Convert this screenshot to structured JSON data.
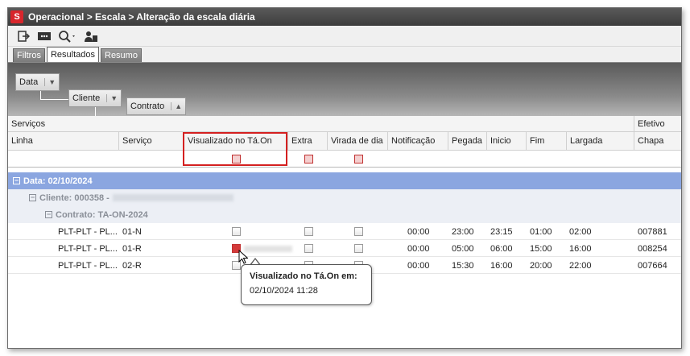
{
  "window": {
    "title": "Operacional > Escala > Alteração da escala diária",
    "logo_letter": "S"
  },
  "toolbar": {
    "icons": [
      "export-icon",
      "message-icon",
      "search-icon",
      "users-icon"
    ]
  },
  "tabs": [
    {
      "label": "Filtros",
      "active": false
    },
    {
      "label": "Resultados",
      "active": true
    },
    {
      "label": "Resumo",
      "active": false
    }
  ],
  "grouping": {
    "chips": [
      {
        "label": "Data",
        "sort": "▼"
      },
      {
        "label": "Cliente",
        "sort": "▼"
      },
      {
        "label": "Contrato",
        "sort": "▲"
      }
    ]
  },
  "grid": {
    "band_headers": {
      "servicos": "Serviços",
      "efetivo": "Efetivo"
    },
    "columns": [
      "Linha",
      "Serviço",
      "Visualizado no Tá.On",
      "Extra",
      "Virada de dia",
      "Notificação",
      "Pegada",
      "Inicio",
      "Fim",
      "Largada",
      "Chapa"
    ],
    "group_data": "Data: 02/10/2024",
    "group_cliente": "Cliente: 000358 -",
    "group_contrato": "Contrato: TA-ON-2024",
    "rows": [
      {
        "linha": "PLT-PLT - PL...",
        "servico": "01-N",
        "visualizado": false,
        "extra": false,
        "virada": false,
        "notificacao": "00:00",
        "pegada": "23:00",
        "inicio": "23:15",
        "fim": "01:00",
        "largada": "02:00",
        "chapa": "007881"
      },
      {
        "linha": "PLT-PLT - PL...",
        "servico": "01-R",
        "visualizado": true,
        "extra": false,
        "virada": false,
        "notificacao": "00:00",
        "pegada": "05:00",
        "inicio": "06:00",
        "fim": "15:00",
        "largada": "16:00",
        "chapa": "008254"
      },
      {
        "linha": "PLT-PLT - PL...",
        "servico": "02-R",
        "visualizado": false,
        "extra": false,
        "virada": false,
        "notificacao": "00:00",
        "pegada": "15:30",
        "inicio": "16:00",
        "fim": "20:00",
        "largada": "22:00",
        "chapa": "007664"
      }
    ]
  },
  "tooltip": {
    "title": "Visualizado no Tá.On em:",
    "body": "02/10/2024 11:28"
  },
  "colors": {
    "group_header": "#8ba6e0",
    "highlight": "#d42020",
    "checkbox_on": "#d43a3a"
  }
}
